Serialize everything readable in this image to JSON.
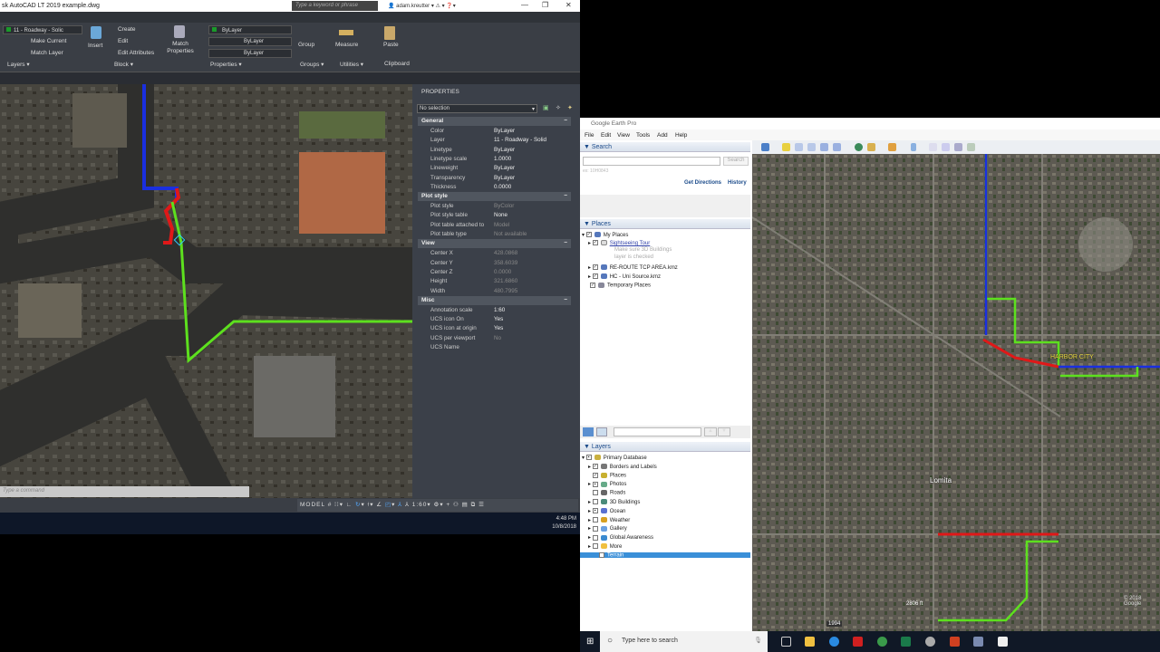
{
  "autocad": {
    "title": "sk AutoCAD LT 2019    example.dwg",
    "search_placeholder": "Type a keyword or phrase",
    "user": "adam.kreutter",
    "layer_dropdown": "11 - Roadway - Solic",
    "layers": {
      "make_current": "Make Current",
      "match_layer": "Match Layer",
      "panel": "Layers ▾"
    },
    "block": {
      "insert": "Insert",
      "create": "Create",
      "edit": "Edit",
      "edit_attributes": "Edit Attributes",
      "panel": "Block ▾"
    },
    "properties_panel": {
      "match": "Match Properties",
      "color": "ByLayer",
      "linetype": "ByLayer",
      "lineweight": "ByLayer",
      "panel": "Properties ▾"
    },
    "groups": {
      "group": "Group",
      "panel": "Groups ▾"
    },
    "utilities": {
      "measure": "Measure",
      "panel": "Utilities ▾"
    },
    "clipboard": {
      "paste": "Paste",
      "panel": "Clipboard"
    },
    "command_placeholder": "Type a command",
    "status": {
      "model": "MODEL",
      "scale": "1:60"
    },
    "clock": {
      "time": "4:48 PM",
      "date": "10/8/2018"
    }
  },
  "properties": {
    "title": "PROPERTIES",
    "selection": "No selection",
    "sections": [
      {
        "name": "General",
        "rows": [
          {
            "k": "Color",
            "v": "ByLayer"
          },
          {
            "k": "Layer",
            "v": "11 - Roadway - Solid"
          },
          {
            "k": "Linetype",
            "v": "ByLayer"
          },
          {
            "k": "Linetype scale",
            "v": "1.0000"
          },
          {
            "k": "Lineweight",
            "v": "ByLayer"
          },
          {
            "k": "Transparency",
            "v": "ByLayer"
          },
          {
            "k": "Thickness",
            "v": "0.0000"
          }
        ]
      },
      {
        "name": "Plot style",
        "rows": [
          {
            "k": "Plot style",
            "v": "ByColor"
          },
          {
            "k": "Plot style table",
            "v": "None"
          },
          {
            "k": "Plot table attached to",
            "v": "Model"
          },
          {
            "k": "Plot table type",
            "v": "Not available"
          }
        ]
      },
      {
        "name": "View",
        "rows": [
          {
            "k": "Center X",
            "v": "428.0868"
          },
          {
            "k": "Center Y",
            "v": "358.6039"
          },
          {
            "k": "Center Z",
            "v": "0.0000"
          },
          {
            "k": "Height",
            "v": "321.6860"
          },
          {
            "k": "Width",
            "v": "480.7995"
          }
        ]
      },
      {
        "name": "Misc",
        "rows": [
          {
            "k": "Annotation scale",
            "v": "1:60"
          },
          {
            "k": "UCS icon On",
            "v": "Yes"
          },
          {
            "k": "UCS icon at origin",
            "v": "Yes"
          },
          {
            "k": "UCS per viewport",
            "v": "No"
          },
          {
            "k": "UCS Name",
            "v": ""
          }
        ]
      }
    ]
  },
  "earth": {
    "title": "Google Earth Pro",
    "menu": [
      "File",
      "Edit",
      "View",
      "Tools",
      "Add",
      "Help"
    ],
    "search": {
      "header": "▼ Search",
      "button": "Search",
      "hint": "ex: 10H0843",
      "directions": "Get Directions",
      "history": "History"
    },
    "places": {
      "header": "▼ Places",
      "items": [
        {
          "label": "My Places"
        },
        {
          "label": "Sightseeing Tour"
        },
        {
          "label": "Make sure 3D Buildings"
        },
        {
          "label": "layer is checked"
        },
        {
          "label": "RE-ROUTE TCP AREA.kmz"
        },
        {
          "label": "HC - Uni Source.kmz"
        },
        {
          "label": "Temporary Places"
        }
      ]
    },
    "layers": {
      "header": "▼ Layers",
      "items": [
        {
          "label": "Primary Database"
        },
        {
          "label": "Borders and Labels"
        },
        {
          "label": "Places"
        },
        {
          "label": "Photos"
        },
        {
          "label": "Roads"
        },
        {
          "label": "3D Buildings"
        },
        {
          "label": "Ocean"
        },
        {
          "label": "Weather"
        },
        {
          "label": "Gallery"
        },
        {
          "label": "Global Awareness"
        },
        {
          "label": "More"
        },
        {
          "label": "Terrain"
        }
      ]
    },
    "map": {
      "label_harbor": "HARBOR CITY",
      "label_lomita": "Lomita",
      "elevation": "2806 ft",
      "year": "1994",
      "copyright": "© 2018 Google"
    }
  },
  "taskbar": {
    "search_placeholder": "Type here to search"
  },
  "colors": {
    "route_blue": "#1a2fe0",
    "route_green": "#5de01e",
    "route_red": "#e01818",
    "highlight": "#3a8fd8"
  }
}
